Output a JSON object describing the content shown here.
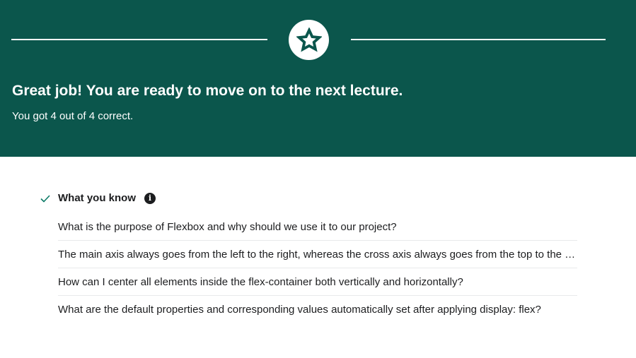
{
  "hero": {
    "title": "Great job! You are ready to move on to the next lecture.",
    "subtitle": "You got 4 out of 4 correct.",
    "background": "#0b564c"
  },
  "section": {
    "heading": "What you know",
    "info_glyph": "i",
    "questions": [
      "What is the purpose of Flexbox and why should we use it to our project?",
      "The main axis always goes from the left to the right, whereas the cross axis always goes from the top to the bottom?",
      "How can I center all elements inside the flex-container both vertically and horizontally?",
      "What are the default properties and corresponding values automatically set after applying display: flex?"
    ]
  }
}
